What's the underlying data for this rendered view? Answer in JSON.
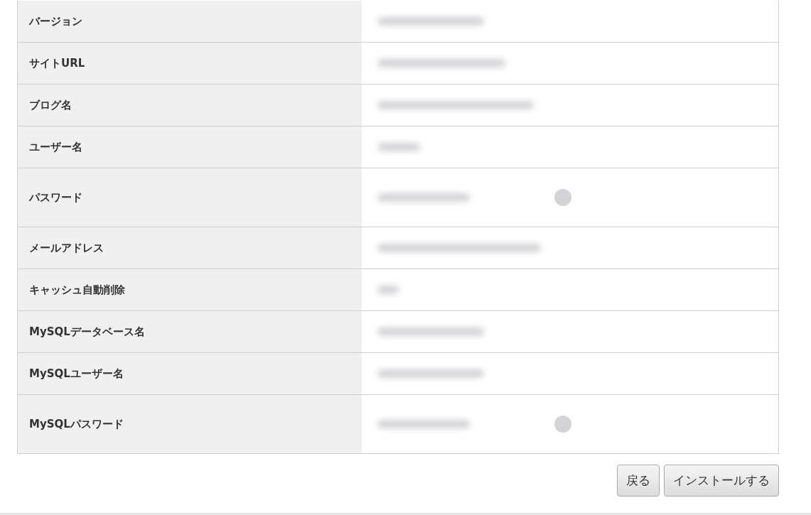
{
  "settings_table": {
    "rows": [
      {
        "label": "バージョン",
        "kind": "text"
      },
      {
        "label": "サイトURL",
        "kind": "text"
      },
      {
        "label": "ブログ名",
        "kind": "text"
      },
      {
        "label": "ユーザー名",
        "kind": "text"
      },
      {
        "label": "パスワード",
        "kind": "password"
      },
      {
        "label": "メールアドレス",
        "kind": "text"
      },
      {
        "label": "キャッシュ自動削除",
        "kind": "text"
      },
      {
        "label": "MySQLデータベース名",
        "kind": "text"
      },
      {
        "label": "MySQLユーザー名",
        "kind": "text"
      },
      {
        "label": "MySQLパスワード",
        "kind": "password"
      }
    ]
  },
  "buttons": [
    "戻る",
    "インストールする"
  ]
}
